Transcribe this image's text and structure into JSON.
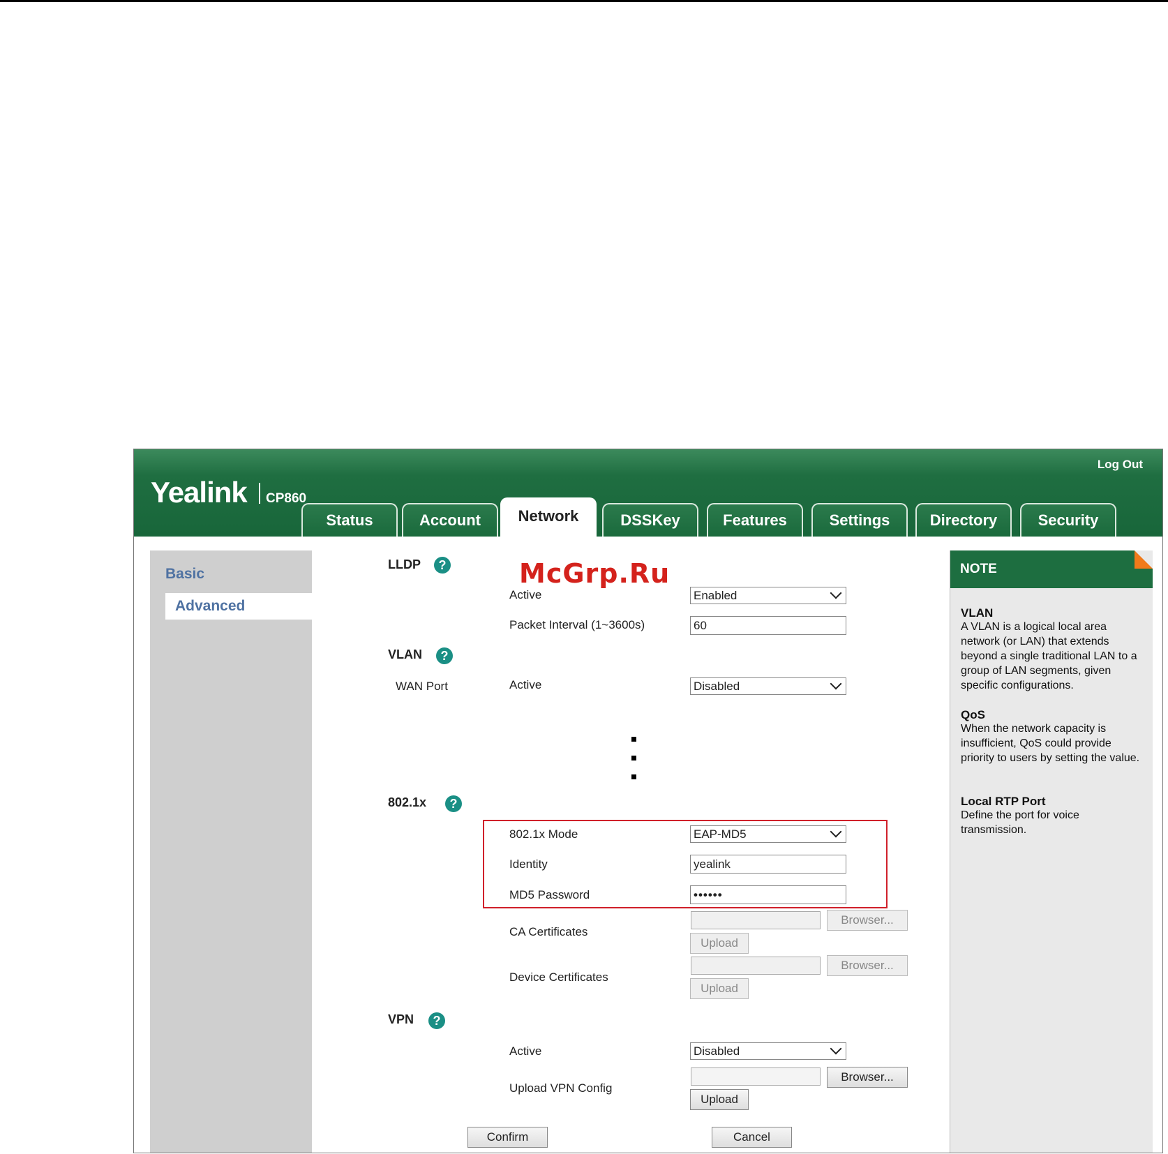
{
  "brand": {
    "logo": "Yealink",
    "model": "CP860",
    "logout": "Log Out"
  },
  "tabs": [
    "Status",
    "Account",
    "Network",
    "DSSKey",
    "Features",
    "Settings",
    "Directory",
    "Security"
  ],
  "active_tab": "Network",
  "sidebar": {
    "items": [
      "Basic",
      "Advanced"
    ],
    "active": "Advanced"
  },
  "lldp": {
    "title": "LLDP",
    "active_label": "Active",
    "active_value": "Enabled",
    "interval_label": "Packet Interval (1~3600s)",
    "interval_value": "60"
  },
  "vlan": {
    "title": "VLAN",
    "port_label": "WAN Port",
    "active_label": "Active",
    "active_value": "Disabled"
  },
  "dot1x": {
    "title": "802.1x",
    "mode_label": "802.1x Mode",
    "mode_value": "EAP-MD5",
    "identity_label": "Identity",
    "identity_value": "yealink",
    "password_label": "MD5 Password",
    "password_value": "••••••",
    "ca_label": "CA Certificates",
    "device_label": "Device Certificates",
    "browse_label": "Browser...",
    "upload_label": "Upload"
  },
  "vpn": {
    "title": "VPN",
    "active_label": "Active",
    "active_value": "Disabled",
    "upload_config_label": "Upload VPN Config",
    "browse_label": "Browser...",
    "upload_label": "Upload"
  },
  "actions": {
    "confirm": "Confirm",
    "cancel": "Cancel"
  },
  "note": {
    "header": "NOTE",
    "items": [
      {
        "title": "VLAN",
        "text": "A VLAN is a logical local area network (or LAN) that extends beyond a single traditional LAN to a group of LAN segments, given specific configurations."
      },
      {
        "title": "QoS",
        "text": "When the network capacity is insufficient, QoS could provide priority to users by setting the value."
      },
      {
        "title": "Local RTP Port",
        "text": "Define the port for voice transmission."
      }
    ]
  },
  "watermark": "McGrp.Ru",
  "colors": {
    "header_green": "#1d6e40",
    "highlight_red": "#d0202a",
    "nav_link": "#4f72a2",
    "help_teal": "#1a8f85",
    "note_corner": "#f07a1a"
  }
}
